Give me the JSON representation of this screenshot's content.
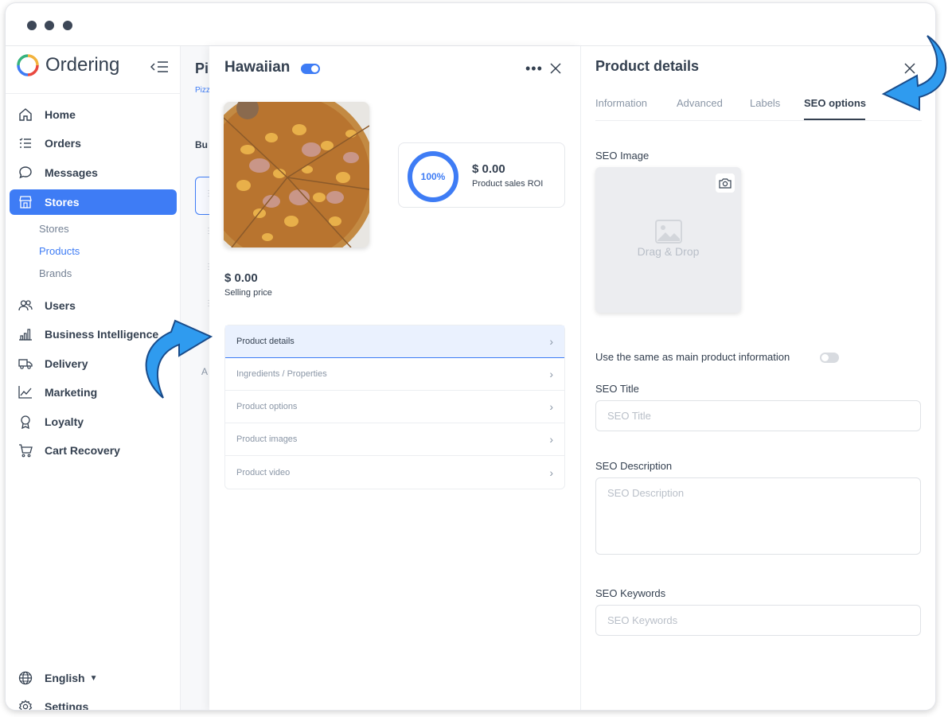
{
  "app": {
    "name": "Ordering",
    "accent": "#3e7cf5"
  },
  "sidebar": {
    "items": [
      {
        "label": "Home",
        "icon": "home-icon"
      },
      {
        "label": "Orders",
        "icon": "list-icon"
      },
      {
        "label": "Messages",
        "icon": "chat-icon"
      },
      {
        "label": "Stores",
        "icon": "store-icon",
        "active": true
      },
      {
        "label": "Users",
        "icon": "users-icon"
      },
      {
        "label": "Business Intelligence",
        "icon": "bar-chart-icon"
      },
      {
        "label": "Delivery",
        "icon": "truck-icon"
      },
      {
        "label": "Marketing",
        "icon": "line-chart-icon"
      },
      {
        "label": "Loyalty",
        "icon": "award-icon"
      },
      {
        "label": "Cart Recovery",
        "icon": "cart-icon"
      }
    ],
    "sub_items": [
      "Stores",
      "Products",
      "Brands"
    ],
    "language": "English",
    "settings": "Settings"
  },
  "background": {
    "heading_partial": "Pi",
    "breadcrumb_partial": "Pizz",
    "section_partial": "Bu",
    "letter_partial": "A"
  },
  "product": {
    "name": "Hawaiian",
    "roi_percent": "100%",
    "roi_value": "$ 0.00",
    "roi_label": "Product sales ROI",
    "price": "$ 0.00",
    "price_label": "Selling price",
    "menu": [
      "Product details",
      "Ingredients / Properties",
      "Product options",
      "Product images",
      "Product video"
    ]
  },
  "details": {
    "title": "Product details",
    "tabs": [
      "Information",
      "Advanced",
      "Labels",
      "SEO options"
    ],
    "active_tab": "SEO options",
    "seo_image_label": "SEO Image",
    "drag_drop": "Drag & Drop",
    "same_as_main": "Use the same as main product information",
    "seo_title_label": "SEO Title",
    "seo_title_placeholder": "SEO Title",
    "seo_description_label": "SEO Description",
    "seo_description_placeholder": "SEO Description",
    "seo_keywords_label": "SEO Keywords",
    "seo_keywords_placeholder": "SEO Keywords"
  }
}
